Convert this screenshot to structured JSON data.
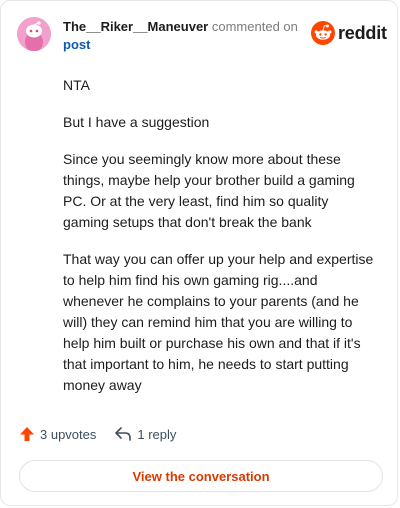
{
  "header": {
    "username": "The__Riker__Maneuver",
    "action_text": "commented on",
    "post_link": "post"
  },
  "logo": {
    "text": "reddit",
    "icon": "reddit-alien-icon",
    "color": "#ff4500"
  },
  "comment": {
    "paragraphs": [
      "NTA",
      "But I have a suggestion",
      "Since you seemingly know more about these things, maybe help your brother build a gaming PC. Or at the very least, find him so quality gaming setups that don't break the bank",
      "That way you can offer up your help and expertise to help him find his own gaming rig....and whenever he complains to your parents (and he will) they can remind him that you are willing to help him built or purchase his own and that if it's that important to him, he needs to start putting money away"
    ]
  },
  "footer": {
    "upvotes": "3 upvotes",
    "replies": "1 reply",
    "upvote_icon": "upvote-arrow-icon",
    "reply_icon": "reply-arrow-icon",
    "upvote_color": "#ff4500"
  },
  "cta": {
    "label": "View the conversation",
    "color": "#d93a00"
  }
}
